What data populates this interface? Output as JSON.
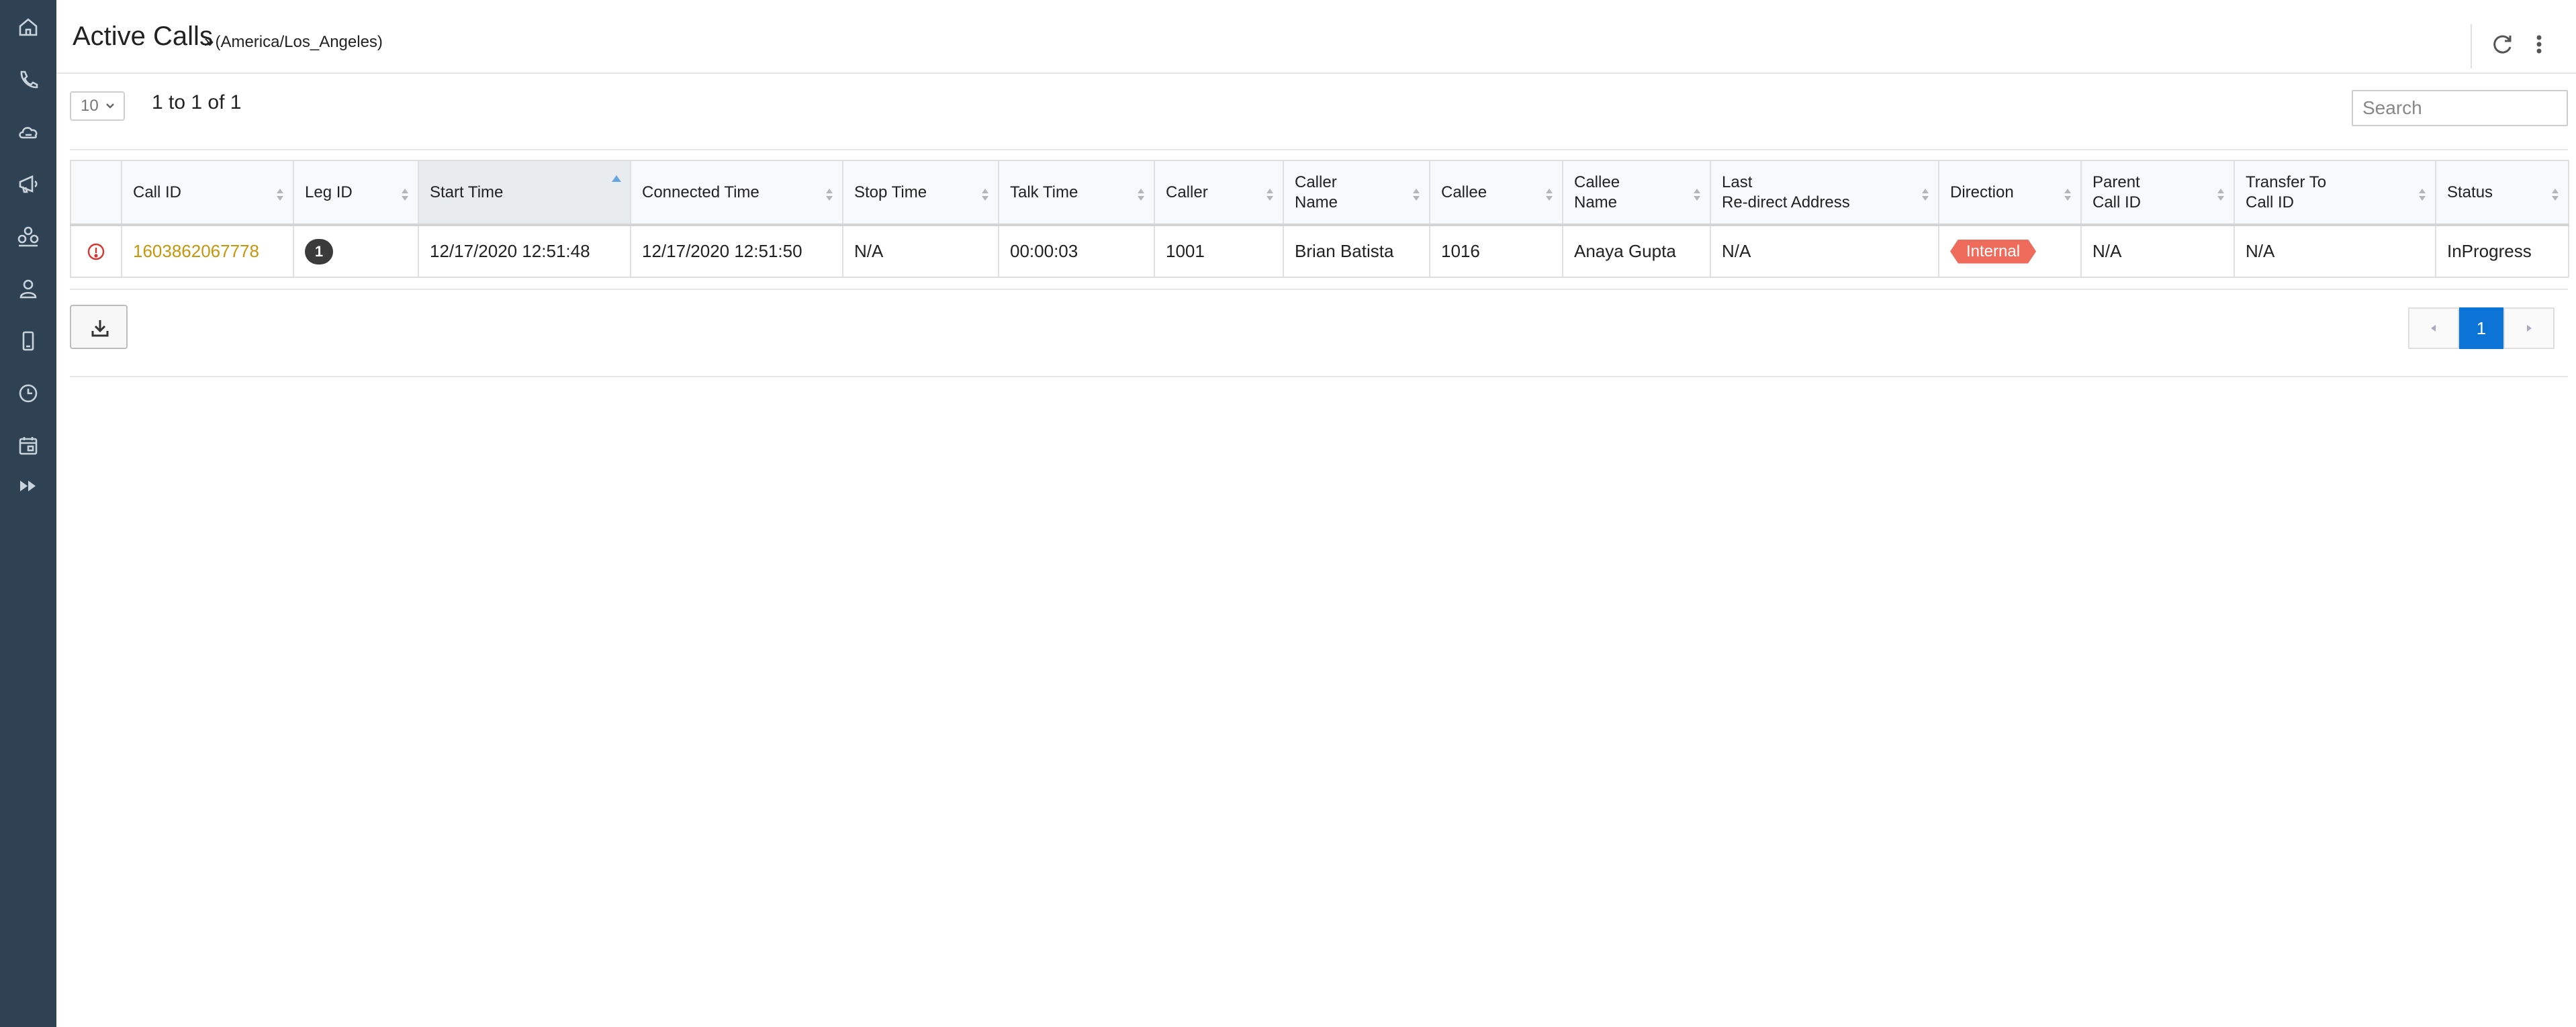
{
  "sidebar": {
    "items": [
      {
        "icon": "home-icon"
      },
      {
        "icon": "phone-icon"
      },
      {
        "icon": "cloud-icon"
      },
      {
        "icon": "announcement-icon"
      },
      {
        "icon": "group-icon"
      },
      {
        "icon": "user-icon"
      },
      {
        "icon": "mobile-icon"
      },
      {
        "icon": "clock-icon"
      },
      {
        "icon": "calendar-icon"
      },
      {
        "icon": "fast-forward-icon"
      }
    ]
  },
  "header": {
    "title": "Active Calls",
    "timezone": "(America/Los_Angeles)",
    "timezone_prefix": "»"
  },
  "toolbar": {
    "page_size": "10",
    "range_text": "1 to 1 of 1",
    "search_placeholder": "Search"
  },
  "table": {
    "columns": [
      {
        "line1": "",
        "line2": ""
      },
      {
        "line1": "Call ID",
        "line2": ""
      },
      {
        "line1": "Leg ID",
        "line2": ""
      },
      {
        "line1": "Start Time",
        "line2": ""
      },
      {
        "line1": "Connected Time",
        "line2": ""
      },
      {
        "line1": "Stop Time",
        "line2": ""
      },
      {
        "line1": "Talk Time",
        "line2": ""
      },
      {
        "line1": "Caller",
        "line2": ""
      },
      {
        "line1": "Caller",
        "line2": "Name"
      },
      {
        "line1": "Callee",
        "line2": ""
      },
      {
        "line1": "Callee",
        "line2": "Name"
      },
      {
        "line1": "Last",
        "line2": "Re-direct Address"
      },
      {
        "line1": "Direction",
        "line2": ""
      },
      {
        "line1": "Parent",
        "line2": "Call ID"
      },
      {
        "line1": "Transfer To",
        "line2": "Call ID"
      },
      {
        "line1": "Status",
        "line2": ""
      }
    ],
    "rows": [
      {
        "call_id": "1603862067778",
        "leg_id": "1",
        "start_time": "12/17/2020 12:51:48",
        "connected_time": "12/17/2020 12:51:50",
        "stop_time": "N/A",
        "talk_time": "00:00:03",
        "caller": "1001",
        "caller_name": "Brian Batista",
        "callee": "1016",
        "callee_name": "Anaya Gupta",
        "last_redirect": "N/A",
        "direction": "Internal",
        "parent_call_id": "N/A",
        "transfer_to_call_id": "N/A",
        "status": "InProgress"
      }
    ]
  },
  "pagination": {
    "current_page": "1"
  },
  "colors": {
    "sidebar_bg": "#2f4253",
    "link": "#c8960a",
    "direction_internal": "#ef6b5b",
    "pager_active": "#0b74d6"
  }
}
